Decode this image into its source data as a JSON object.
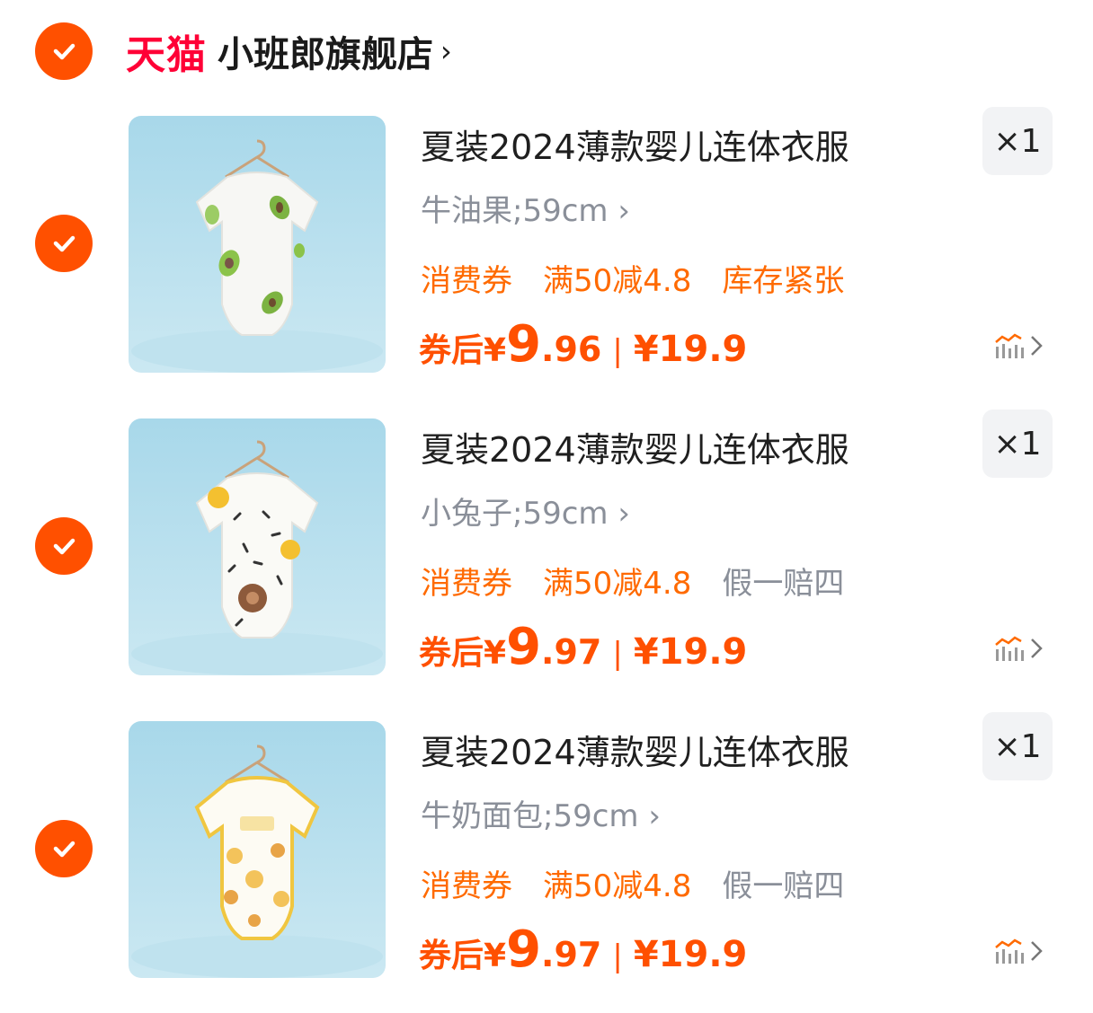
{
  "store": {
    "tmall_label": "天猫",
    "name": "小班郎旗舰店",
    "chevron": "›"
  },
  "colors": {
    "accent": "#ff5000",
    "tag_orange": "#ff6a00",
    "tmall_red": "#ff0036",
    "gray_text": "#8a8f99"
  },
  "items": [
    {
      "title": "夏装2024薄款婴儿连体衣服",
      "qty": "×1",
      "sku": "牛油果;59cm ›",
      "tags": [
        "消费券",
        "满50减4.8",
        "库存紧张"
      ],
      "price_label": "券后¥",
      "price_int": "9",
      "price_dec": ".96",
      "separator": "|",
      "original_price": "¥19.9",
      "checked": true
    },
    {
      "title": "夏装2024薄款婴儿连体衣服",
      "qty": "×1",
      "sku": "小兔子;59cm ›",
      "tags": [
        "消费券",
        "满50减4.8",
        "假一赔四"
      ],
      "price_label": "券后¥",
      "price_int": "9",
      "price_dec": ".97",
      "separator": "|",
      "original_price": "¥19.9",
      "checked": true
    },
    {
      "title": "夏装2024薄款婴儿连体衣服",
      "qty": "×1",
      "sku": "牛奶面包;59cm ›",
      "tags": [
        "消费券",
        "满50减4.8",
        "假一赔四"
      ],
      "price_label": "券后¥",
      "price_int": "9",
      "price_dec": ".97",
      "separator": "|",
      "original_price": "¥19.9",
      "checked": true
    }
  ],
  "icons": {
    "check": "check-icon",
    "trend": "price-trend-icon",
    "chevron": "chevron-right-icon"
  }
}
